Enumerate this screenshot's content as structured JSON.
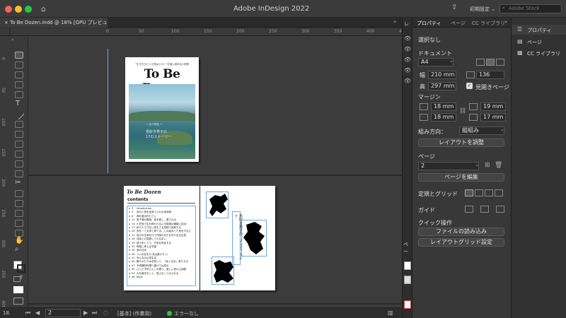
{
  "app": {
    "title": "Adobe InDesign 2022",
    "workspace": "初期設定",
    "search_placeholder": "Adobe Stock"
  },
  "document_tab": {
    "label": "To Be Dozen.indd @ 18% [GPU プレビュー]",
    "close": "×"
  },
  "ruler": {
    "h": [
      "0",
      "50",
      "100",
      "150",
      "200",
      "250",
      "300",
      "350",
      "400",
      "450",
      "500",
      "550"
    ],
    "v": [
      "0",
      "50",
      "100",
      "150",
      "200",
      "250",
      "300",
      "350",
      "400"
    ]
  },
  "cover": {
    "top_text": "\"生き方ひとつで島はとれ！\"を追い求める1年間",
    "title": "To Be Dozen",
    "sub1": "〜 全て同島 〜",
    "sub2": "島好き男子の",
    "sub3": "17のストーリー"
  },
  "spread": {
    "logo": "To Be Dozen",
    "contents_label": "contents",
    "toc": [
      {
        "p": "p",
        "n": "3",
        "t": "introduction"
      },
      {
        "p": "p",
        "n": "5",
        "t": "自分と島を全身で入れの全地域"
      },
      {
        "p": "p",
        "n": "8",
        "t": "海を渡る村ださい"
      },
      {
        "p": "p",
        "n": "11",
        "t": "男子達が親指、島を愛し、愛される"
      },
      {
        "p": "p",
        "n": "14",
        "t": "小豆島で生を終わらるぶき総相の機能に迫る！"
      },
      {
        "p": "p",
        "n": "17",
        "t": "私ら人できない島をさる真物で自助する"
      },
      {
        "p": "p",
        "n": "20",
        "t": "島を一て大学と育てることの絵みとた島を行なさ"
      },
      {
        "p": "p",
        "n": "23",
        "t": "自分の生命を行う作家の日たを作り出る生涯"
      },
      {
        "p": "p",
        "n": "26",
        "t": "住民との見廻して小るまい"
      },
      {
        "p": "p",
        "n": "29",
        "t": "誤十年とうで、方宅を同住する"
      },
      {
        "p": "p",
        "n": "32",
        "t": "神族に考える市道"
      },
      {
        "p": "p",
        "n": "35",
        "t": "島の日本"
      },
      {
        "p": "p",
        "n": "38",
        "t": "ついお互を与 島は楽けすっ！"
      },
      {
        "p": "p",
        "n": "41",
        "t": "みんなの山本生活"
      },
      {
        "p": "p",
        "n": "44",
        "t": "教やかたり木を知って、「私じるな」男たちの"
      },
      {
        "p": "p",
        "n": "47",
        "t": "予成構在料理へ疲けでは成の"
      },
      {
        "p": "p",
        "n": "50",
        "t": "ぶった子供さんこの想う、愛しい島の土地帳"
      },
      {
        "p": "p",
        "n": "53",
        "t": "大を継ぎなこと、島ぶなことほぶれる"
      },
      {
        "p": "p",
        "n": "56",
        "t": "Book"
      }
    ],
    "vertical_text": "島好き男子の、ゾンビ、ライフ"
  },
  "status": {
    "zoom": "18.",
    "page": "2",
    "style": "[基本] (作業用)",
    "errors": "エラーなし"
  },
  "properties": {
    "tabs": [
      "プロパティ",
      "ページ",
      "CC ライブラリ"
    ],
    "selection": "選択なし",
    "document_section": "ドキュメント",
    "page_size": "A4",
    "width_label": "幅",
    "width": "210 mm",
    "height_label": "高",
    "height": "297 mm",
    "pages": "136",
    "facing_pages": "見開きページ",
    "margin_section": "マージン",
    "margin_top": "18 mm",
    "margin_bottom": "18 mm",
    "margin_inside": "19 mm",
    "margin_outside": "17 mm",
    "binding_label": "組み方向：",
    "binding_value": "縦組み",
    "adjust_layout": "レイアウトを調整",
    "page_section": "ページ",
    "page_value": "2",
    "edit_page": "ページを編集",
    "rulers_grids": "定規とグリッド",
    "guides": "ガイド",
    "quick_actions": "クイック操作",
    "import_file": "ファイルの読み込み",
    "layout_grid": "レイアウトグリッド設定"
  },
  "strip_labels": {
    "layers": "レ",
    "pages": "ペー"
  },
  "right_panel": {
    "items": [
      "プロパティ",
      "ページ",
      "CC ライブラリ"
    ]
  },
  "colors": {
    "accent": "#6fa8dc",
    "red": "#ff5f57",
    "yellow": "#febc2e",
    "green": "#28c840"
  }
}
